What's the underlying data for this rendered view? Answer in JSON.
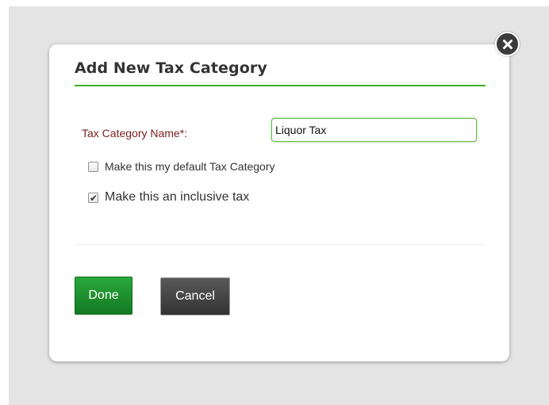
{
  "dialog": {
    "title": "Add New Tax Category",
    "close_icon": "close-icon"
  },
  "form": {
    "name_label": "Tax Category Name*:",
    "name_value": "Liquor Tax",
    "default_checkbox": {
      "label": "Make this my default Tax Category",
      "checked": false
    },
    "inclusive_checkbox": {
      "label": "Make this an inclusive tax",
      "checked": true
    }
  },
  "buttons": {
    "done_label": "Done",
    "cancel_label": "Cancel"
  },
  "colors": {
    "accent_green": "#3fae2a",
    "label_red": "#7d1e1e",
    "done_green": "#1f9530",
    "cancel_dark": "#444444"
  }
}
